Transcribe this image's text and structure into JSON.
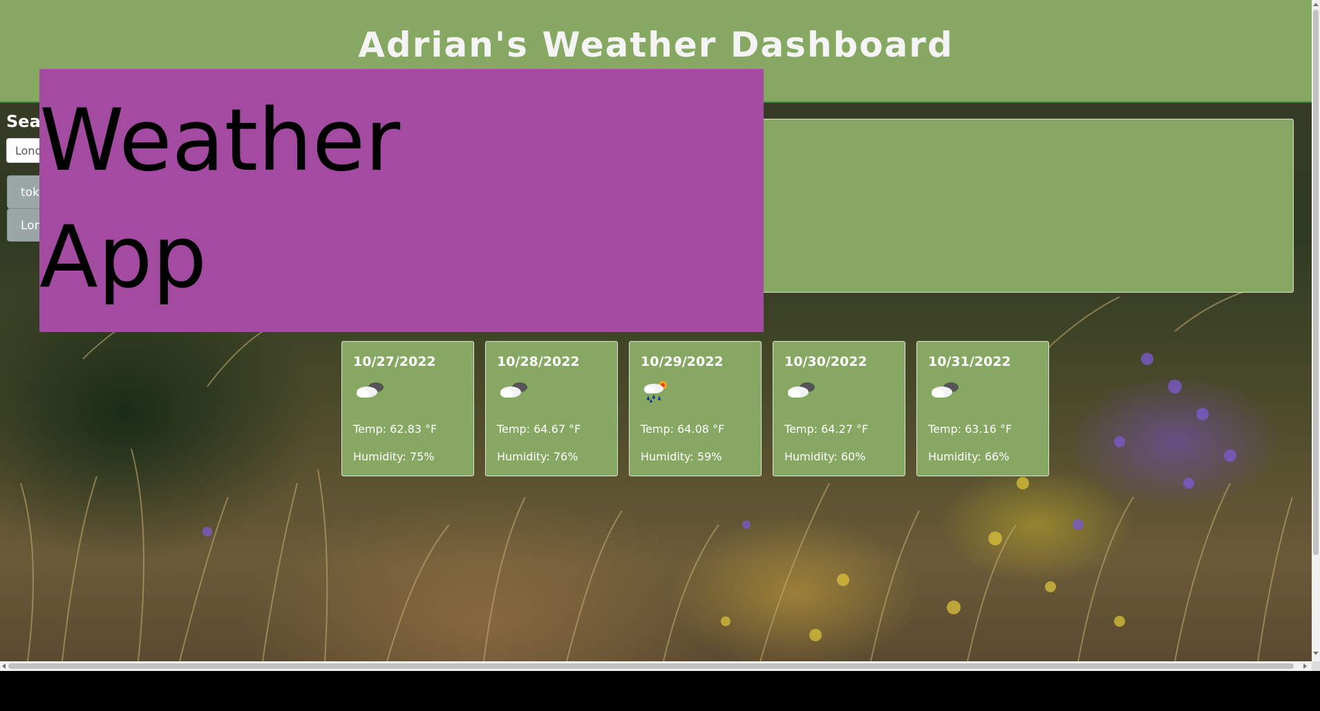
{
  "header": {
    "title": "Adrian's Weather Dashboard"
  },
  "search": {
    "heading": "Search for a City:",
    "input_value": "London"
  },
  "history": [
    {
      "label": "tokyo"
    },
    {
      "label": "London"
    }
  ],
  "banner": {
    "line1": "Weather",
    "line2": "App"
  },
  "forecast": [
    {
      "date": "10/27/2022",
      "icon": "cloudy-icon",
      "temp": "Temp: 62.83 °F",
      "humidity": "Humidity: 75%"
    },
    {
      "date": "10/28/2022",
      "icon": "cloudy-icon",
      "temp": "Temp: 64.67 °F",
      "humidity": "Humidity: 76%"
    },
    {
      "date": "10/29/2022",
      "icon": "rain-sun-icon",
      "temp": "Temp: 64.08 °F",
      "humidity": "Humidity: 59%"
    },
    {
      "date": "10/30/2022",
      "icon": "cloudy-icon",
      "temp": "Temp: 64.27 °F",
      "humidity": "Humidity: 60%"
    },
    {
      "date": "10/31/2022",
      "icon": "cloudy-icon",
      "temp": "Temp: 63.16 °F",
      "humidity": "Humidity: 66%"
    }
  ],
  "colors": {
    "header_bg": "#87a862",
    "banner_bg": "#a34ba0",
    "card_bg": "#87a862",
    "history_btn_bg": "#9aa7a6"
  }
}
